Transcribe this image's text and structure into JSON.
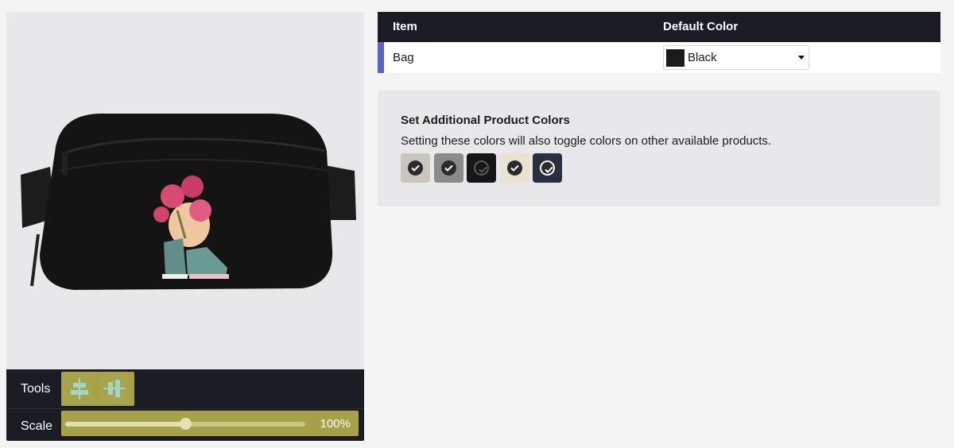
{
  "tools": {
    "label": "Tools"
  },
  "scale": {
    "label": "Scale",
    "value_text": "100%",
    "slider_fraction": 0.5
  },
  "table": {
    "headers": {
      "item": "Item",
      "default_color": "Default Color"
    },
    "rows": [
      {
        "item": "Bag",
        "default_color": "Black",
        "swatch_color": "#1a1a1a"
      }
    ],
    "accent_color": "#5a63d1"
  },
  "colors_card": {
    "title": "Set Additional Product Colors",
    "description": "Setting these colors will also toggle colors on other available products.",
    "swatches": [
      {
        "color": "#c9c6bd",
        "check_color": "#2b2b2b",
        "checked": true
      },
      {
        "color": "#8b8b8b",
        "check_color": "#2b2b2b",
        "checked": true
      },
      {
        "color": "#161616",
        "check_color": "#3a3a3a",
        "checked": true
      },
      {
        "color": "#e9e3cf",
        "check_color": "#2b2b2b",
        "checked": true
      },
      {
        "color": "#2a2f3f",
        "check_color": "#2b2b2b",
        "checked": true
      }
    ]
  },
  "product": {
    "name": "Bag",
    "bag_color": "#141414",
    "print_description": "skull-with-roses-and-sneakers"
  }
}
